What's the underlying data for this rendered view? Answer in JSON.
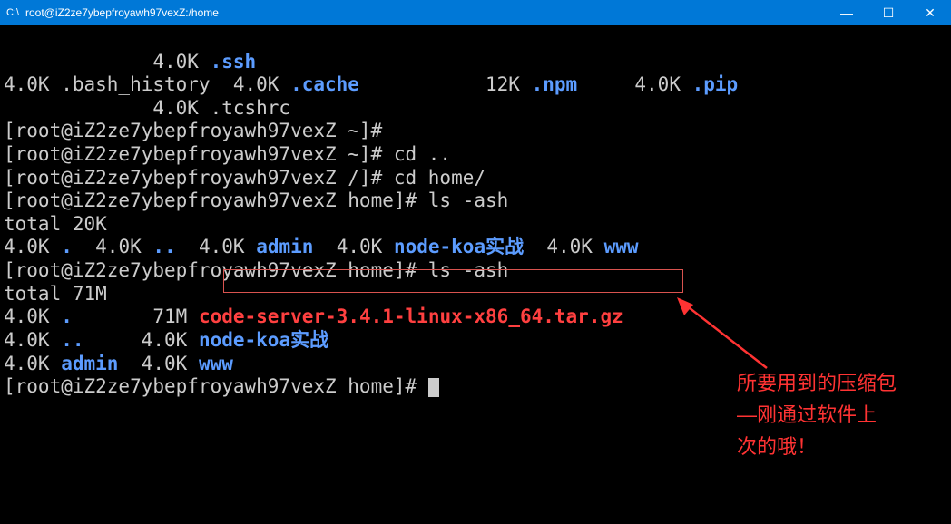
{
  "titlebar": {
    "icon": "C:\\",
    "title": "root@iZ2ze7ybepfroyawh97vexZ:/home",
    "minimize": "—",
    "maximize": "☐",
    "close": "✕"
  },
  "lines": {
    "l1a": "             4.0K ",
    "l1b": ".ssh",
    "l2a": "4.0K .bash_history  4.0K ",
    "l2b": ".cache",
    "l2c": "           12K ",
    "l2d": ".npm",
    "l2e": "     4.0K ",
    "l2f": ".pip",
    "l3": "             4.0K .tcshrc",
    "l4": "[root@iZ2ze7ybepfroyawh97vexZ ~]#",
    "l5": "[root@iZ2ze7ybepfroyawh97vexZ ~]# cd ..",
    "l6": "[root@iZ2ze7ybepfroyawh97vexZ /]# cd home/",
    "l7": "[root@iZ2ze7ybepfroyawh97vexZ home]# ls -ash",
    "l8": "total 20K",
    "l9a": "4.0K ",
    "l9b": ".",
    "l9c": "  4.0K ",
    "l9d": "..",
    "l9e": "  4.0K ",
    "l9f": "admin",
    "l9g": "  4.0K ",
    "l9h": "node-koa实战",
    "l9i": "  4.0K ",
    "l9j": "www",
    "l10": "[root@iZ2ze7ybepfroyawh97vexZ home]# ls -ash",
    "l11": "total 71M",
    "l12a": "4.0K ",
    "l12b": ".",
    "l12c": "       71M ",
    "l12d": "code-server-3.4.1-linux-x86_64.tar.gz",
    "l13a": "4.0K ",
    "l13b": "..",
    "l13c": "     4.0K ",
    "l13d": "node-koa实战",
    "l14a": "4.0K ",
    "l14b": "admin",
    "l14c": "  4.0K ",
    "l14d": "www",
    "l15": "[root@iZ2ze7ybepfroyawh97vexZ home]# "
  },
  "annotation": {
    "line1": "所要用到的压缩包",
    "line2": "—刚通过软件上",
    "line3": "次的哦！"
  }
}
